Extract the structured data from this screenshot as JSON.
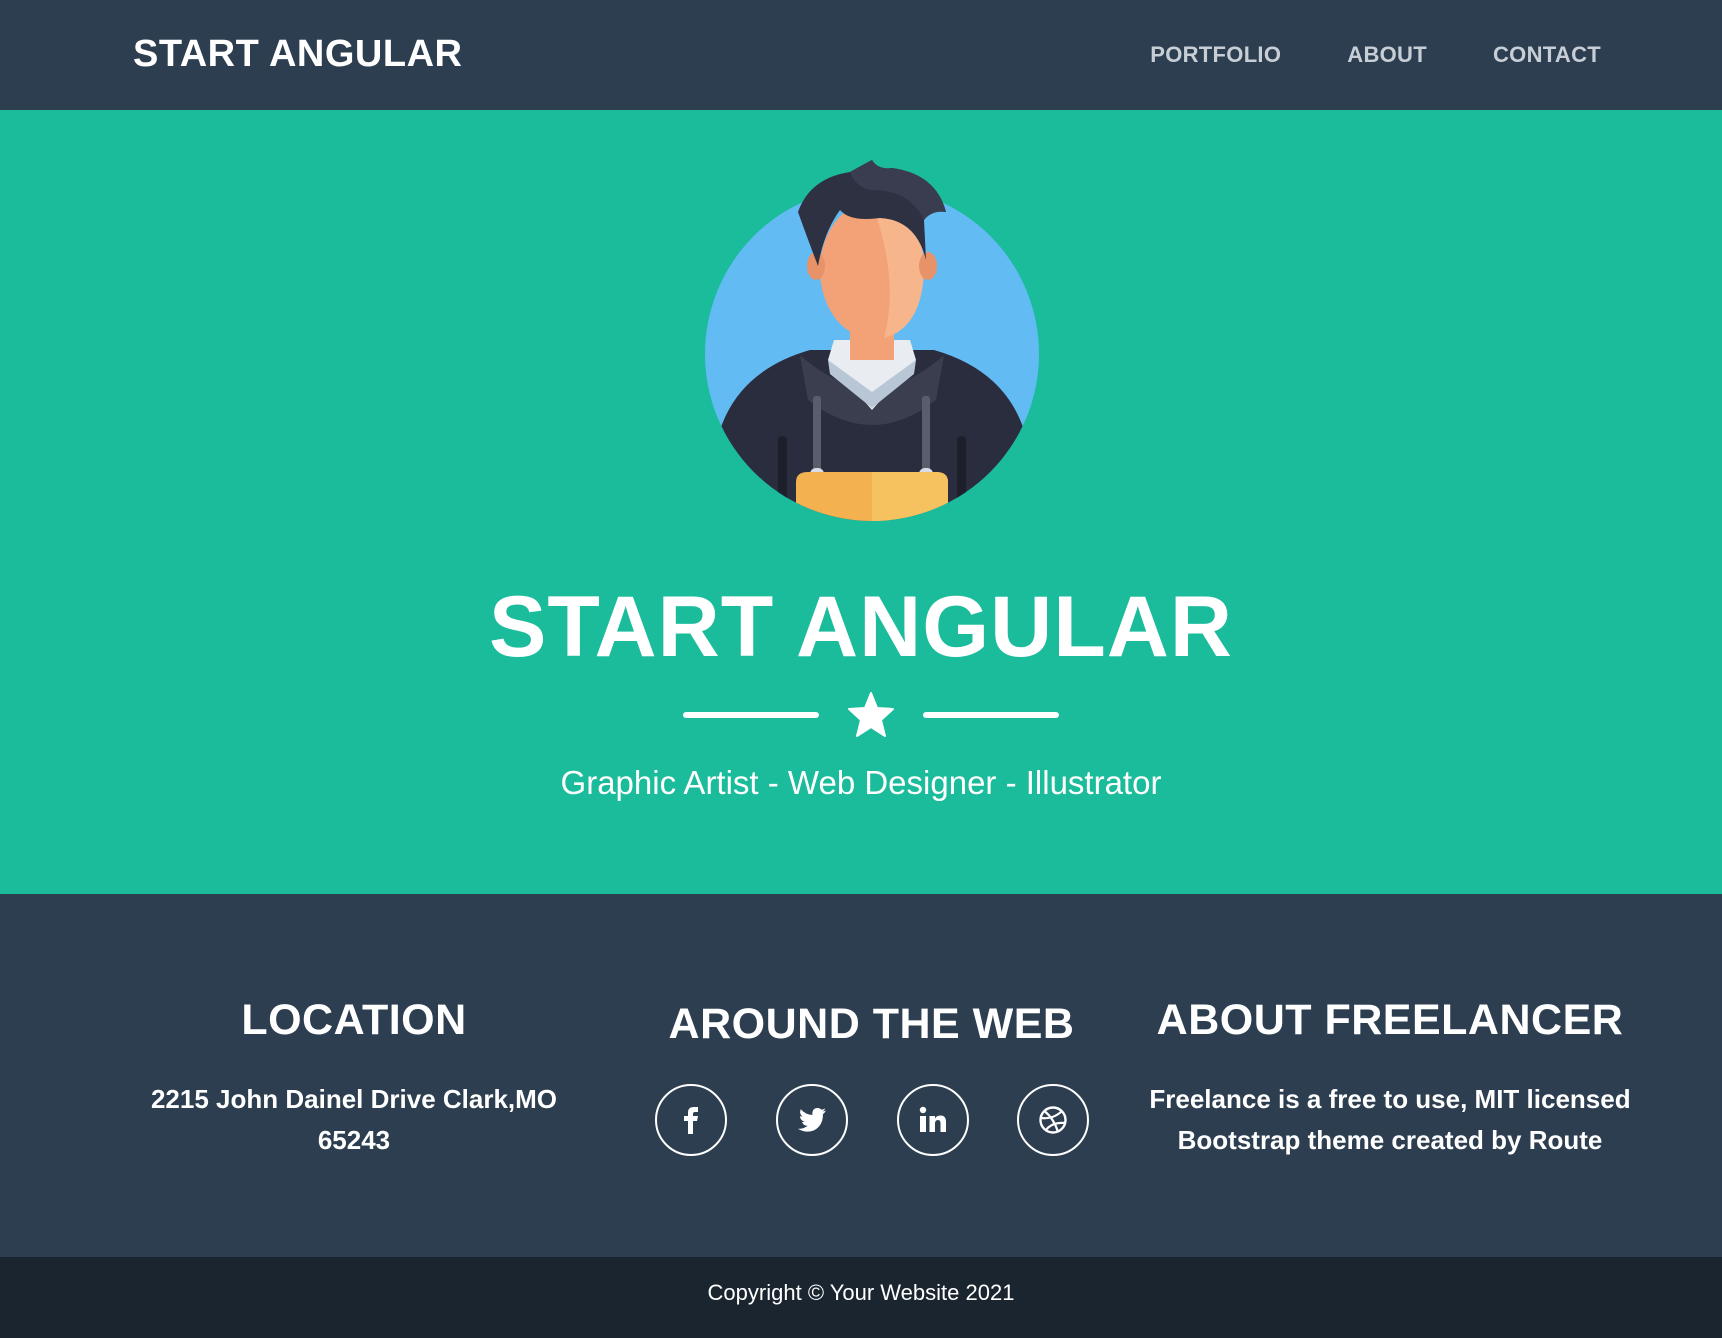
{
  "nav": {
    "brand": "START ANGULAR",
    "links": [
      "PORTFOLIO",
      "ABOUT",
      "CONTACT"
    ]
  },
  "hero": {
    "avatar_icon": "avatar-illustration",
    "title": "START ANGULAR",
    "divider_icon": "star-icon",
    "subtitle": "Graphic Artist - Web Designer - Illustrator"
  },
  "footer": {
    "location": {
      "heading": "LOCATION",
      "address_line1": "2215 John Dainel Drive Clark,MO",
      "address_line2": "65243"
    },
    "web": {
      "heading": "AROUND THE WEB",
      "socials": [
        "facebook-icon",
        "twitter-icon",
        "linkedin-icon",
        "dribbble-icon"
      ]
    },
    "about": {
      "heading": "ABOUT FREELANCER",
      "line1": "Freelance is a free to use, MIT licensed",
      "line2": "Bootstrap theme created by Route"
    }
  },
  "copyright": "Copyright © Your Website 2021",
  "colors": {
    "primary": "#2c3e50",
    "accent": "#1abc9c",
    "dark": "#1a252f"
  }
}
